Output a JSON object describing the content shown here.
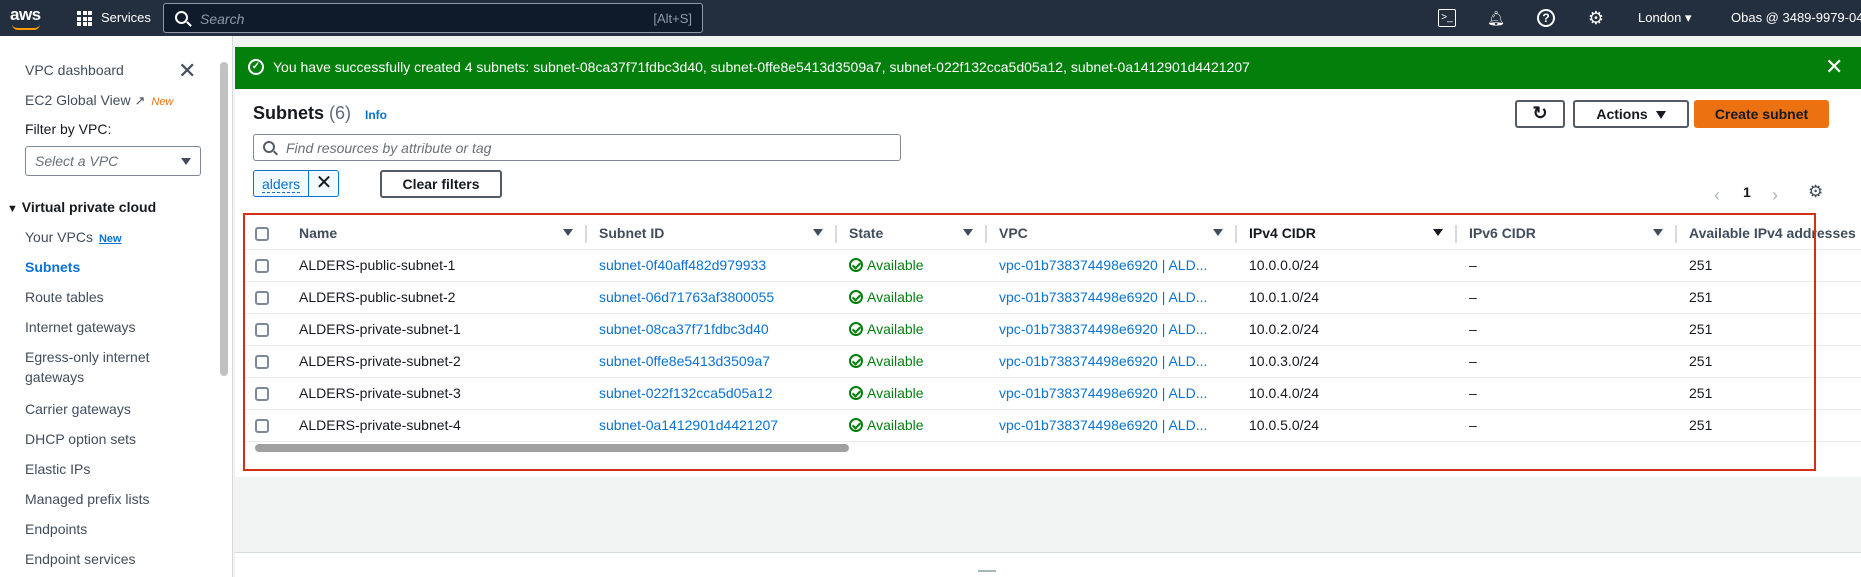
{
  "topnav": {
    "logo": "aws",
    "services": "Services",
    "search_placeholder": "Search",
    "search_shortcut": "[Alt+S]",
    "region": "London ▾",
    "account": "Obas @ 3489-9979-04"
  },
  "sidebar": {
    "items": [
      {
        "label": "VPC dashboard"
      },
      {
        "label": "EC2 Global View",
        "badge": "New"
      },
      {
        "label": "Filter by VPC:"
      },
      {
        "label": "Your VPCs",
        "badge": "New"
      },
      {
        "label": "Subnets"
      },
      {
        "label": "Route tables"
      },
      {
        "label": "Internet gateways"
      },
      {
        "label": "Egress-only internet"
      },
      {
        "label": "gateways"
      },
      {
        "label": "Carrier gateways"
      },
      {
        "label": "DHCP option sets"
      },
      {
        "label": "Elastic IPs"
      },
      {
        "label": "Managed prefix lists"
      },
      {
        "label": "Endpoints"
      },
      {
        "label": "Endpoint services"
      }
    ],
    "vpc_select_placeholder": "Select a VPC",
    "section_title": "Virtual private cloud"
  },
  "flash": {
    "message": "You have successfully created 4 subnets: subnet-08ca37f71fdbc3d40, subnet-0ffe8e5413d3509a7, subnet-022f132cca5d05a12, subnet-0a1412901d4421207"
  },
  "header": {
    "title": "Subnets",
    "count": "(6)",
    "info": "Info",
    "actions": "Actions",
    "create": "Create subnet",
    "filter_placeholder": "Find resources by attribute or tag",
    "token": "alders",
    "clear_filters": "Clear filters",
    "page": "1"
  },
  "table": {
    "columns": [
      "Name",
      "Subnet ID",
      "State",
      "VPC",
      "IPv4 CIDR",
      "IPv6 CIDR",
      "Available IPv4 addresses"
    ],
    "rows": [
      {
        "name": "ALDERS-public-subnet-1",
        "id": "subnet-0f40aff482d979933",
        "state": "Available",
        "vpc": "vpc-01b738374498e6920 | ALD...",
        "ipv4": "10.0.0.0/24",
        "ipv6": "–",
        "avail": "251"
      },
      {
        "name": "ALDERS-public-subnet-2",
        "id": "subnet-06d71763af3800055",
        "state": "Available",
        "vpc": "vpc-01b738374498e6920 | ALD...",
        "ipv4": "10.0.1.0/24",
        "ipv6": "–",
        "avail": "251"
      },
      {
        "name": "ALDERS-private-subnet-1",
        "id": "subnet-08ca37f71fdbc3d40",
        "state": "Available",
        "vpc": "vpc-01b738374498e6920 | ALD...",
        "ipv4": "10.0.2.0/24",
        "ipv6": "–",
        "avail": "251"
      },
      {
        "name": "ALDERS-private-subnet-2",
        "id": "subnet-0ffe8e5413d3509a7",
        "state": "Available",
        "vpc": "vpc-01b738374498e6920 | ALD...",
        "ipv4": "10.0.3.0/24",
        "ipv6": "–",
        "avail": "251"
      },
      {
        "name": "ALDERS-private-subnet-3",
        "id": "subnet-022f132cca5d05a12",
        "state": "Available",
        "vpc": "vpc-01b738374498e6920 | ALD...",
        "ipv4": "10.0.4.0/24",
        "ipv6": "–",
        "avail": "251"
      },
      {
        "name": "ALDERS-private-subnet-4",
        "id": "subnet-0a1412901d4421207",
        "state": "Available",
        "vpc": "vpc-01b738374498e6920 | ALD...",
        "ipv4": "10.0.5.0/24",
        "ipv6": "–",
        "avail": "251"
      }
    ]
  },
  "colors": {
    "nav_bg": "#232f3e",
    "success": "#037f0c",
    "link": "#0972d3",
    "primary_button": "#ec7211",
    "highlight_outline": "#d13212"
  }
}
